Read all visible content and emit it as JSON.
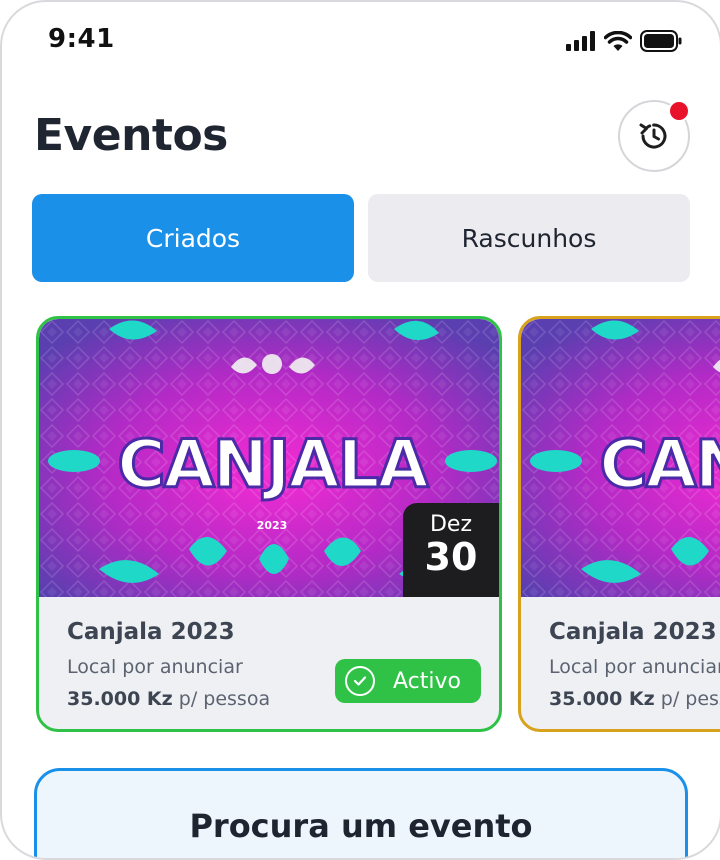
{
  "status_bar": {
    "time": "9:41"
  },
  "header": {
    "title": "Eventos"
  },
  "tabs": [
    {
      "label": "Criados",
      "active": true
    },
    {
      "label": "Rascunhos",
      "active": false
    }
  ],
  "events": [
    {
      "image_title": "CANJALA",
      "image_year": "2023",
      "date_month": "Dez",
      "date_day": "30",
      "title": "Canjala 2023",
      "location": "Local por anunciar",
      "price": "35.000 Kz",
      "price_suffix": "p/ pessoa",
      "status": "Activo",
      "border_color": "#2fc246"
    },
    {
      "image_title": "CANJALA",
      "title": "Canjala 2023",
      "location": "Local por anunciar",
      "price": "35.000 Kz",
      "price_suffix": "p/ pessoa",
      "border_color": "#d8a21c"
    }
  ],
  "search_banner": {
    "title": "Procura um evento"
  },
  "colors": {
    "accent": "#1a90e8",
    "active_status": "#2fc246",
    "draft_border": "#d8a21c",
    "notification": "#e8122b"
  },
  "icons": {
    "history": "history-icon",
    "status_check": "check-circle-icon",
    "signal": "signal-icon",
    "wifi": "wifi-icon",
    "battery": "battery-icon"
  }
}
